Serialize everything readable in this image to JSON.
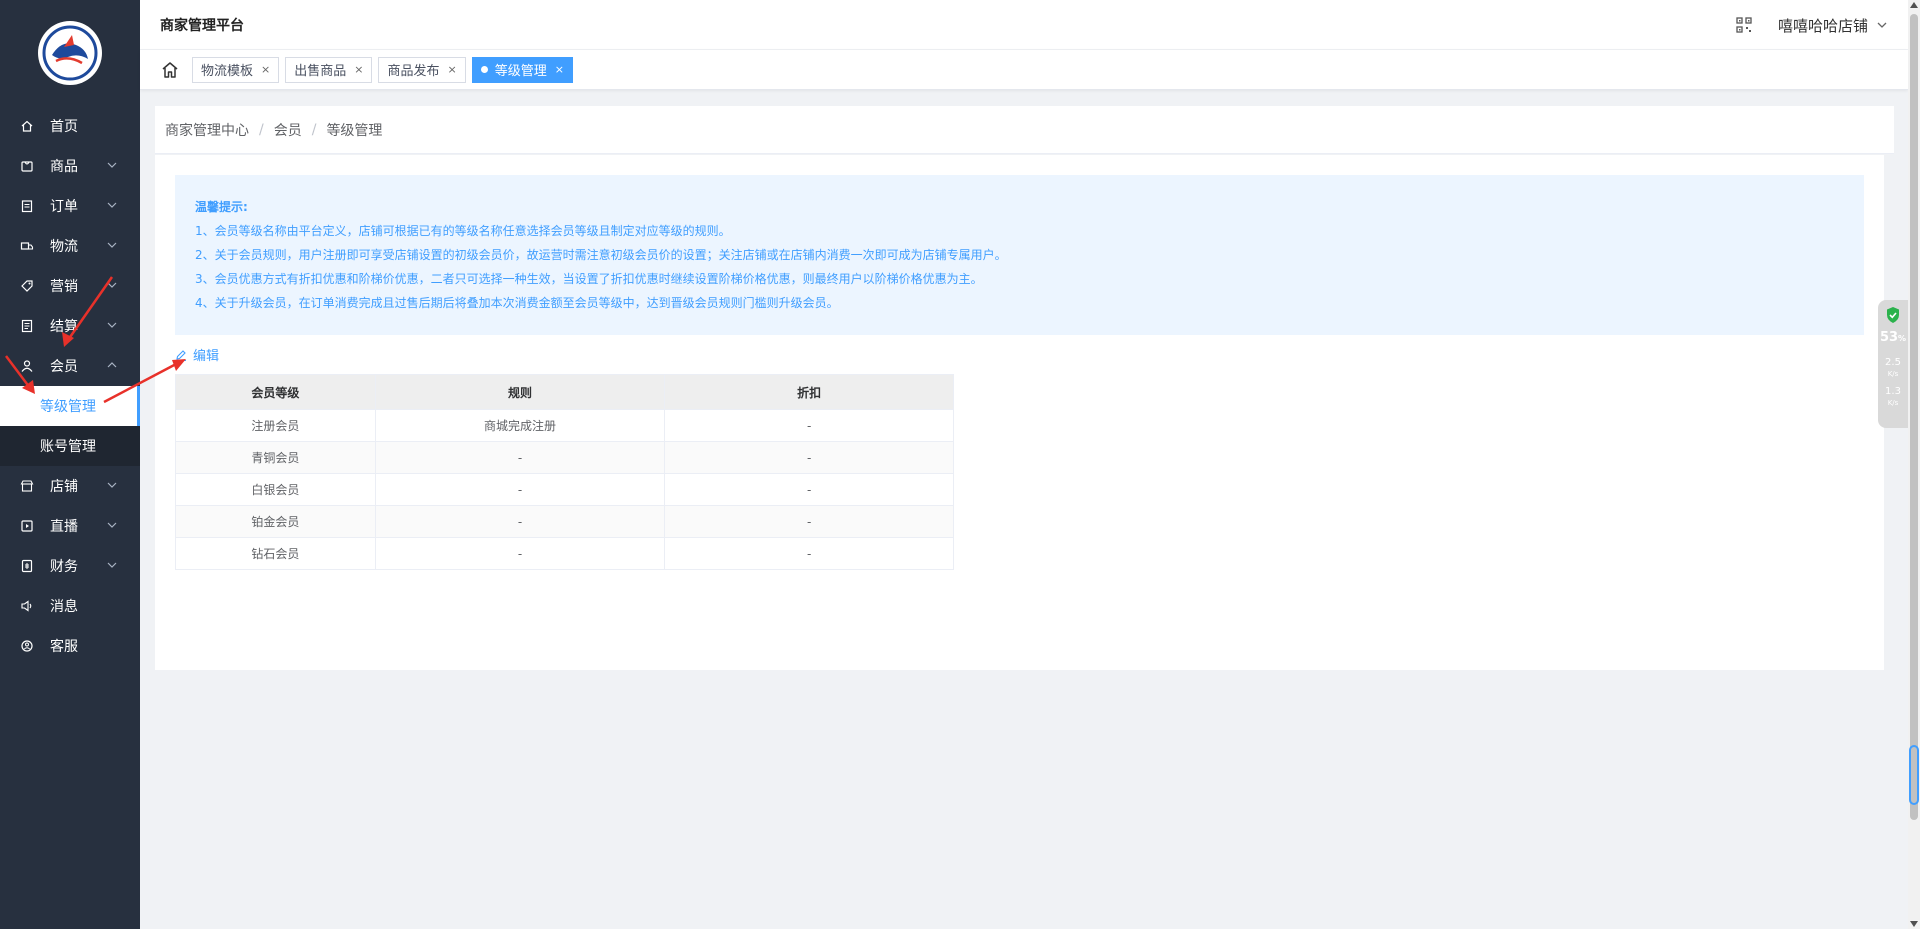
{
  "header": {
    "platform_title": "商家管理平台",
    "shop_name": "嘻嘻哈哈店铺"
  },
  "sidebar": {
    "items": [
      {
        "label": "首页",
        "icon": "home-icon",
        "has_children": false
      },
      {
        "label": "商品",
        "icon": "goods-icon",
        "has_children": true
      },
      {
        "label": "订单",
        "icon": "order-icon",
        "has_children": true
      },
      {
        "label": "物流",
        "icon": "truck-icon",
        "has_children": true
      },
      {
        "label": "营销",
        "icon": "tag-icon",
        "has_children": true
      },
      {
        "label": "结算",
        "icon": "ledger-icon",
        "has_children": true
      },
      {
        "label": "会员",
        "icon": "user-icon",
        "has_children": true,
        "expanded": true
      },
      {
        "label": "店铺",
        "icon": "shop-icon",
        "has_children": true
      },
      {
        "label": "直播",
        "icon": "live-icon",
        "has_children": true
      },
      {
        "label": "财务",
        "icon": "finance-icon",
        "has_children": true
      },
      {
        "label": "消息",
        "icon": "speaker-icon",
        "has_children": false
      },
      {
        "label": "客服",
        "icon": "service-icon",
        "has_children": false
      }
    ],
    "member_submenu": [
      {
        "label": "等级管理",
        "active": true
      },
      {
        "label": "账号管理",
        "active": false
      }
    ]
  },
  "tabs": [
    {
      "label": "物流模板",
      "active": false
    },
    {
      "label": "出售商品",
      "active": false
    },
    {
      "label": "商品发布",
      "active": false
    },
    {
      "label": "等级管理",
      "active": true
    }
  ],
  "tab_close_glyph": "×",
  "breadcrumb": [
    "商家管理中心",
    "会员",
    "等级管理"
  ],
  "breadcrumb_sep": "/",
  "tips": {
    "title": "温馨提示:",
    "lines": [
      "1、会员等级名称由平台定义，店铺可根据已有的等级名称任意选择会员等级且制定对应等级的规则。",
      "2、关于会员规则，用户注册即可享受店铺设置的初级会员价，故运营时需注意初级会员价的设置；关注店铺或在店铺内消费一次即可成为店铺专属用户。",
      "3、会员优惠方式有折扣优惠和阶梯价优惠，二者只可选择一种生效，当设置了折扣优惠时继续设置阶梯价格优惠，则最终用户以阶梯价格优惠为主。",
      "4、关于升级会员，在订单消费完成且过售后期后将叠加本次消费金额至会员等级中，达到晋级会员规则门槛则升级会员。"
    ]
  },
  "edit_label": "编辑",
  "table": {
    "headers": [
      "会员等级",
      "规则",
      "折扣"
    ],
    "rows": [
      [
        "注册会员",
        "商城完成注册",
        "-"
      ],
      [
        "青铜会员",
        "-",
        "-"
      ],
      [
        "白银会员",
        "-",
        "-"
      ],
      [
        "铂金会员",
        "-",
        "-"
      ],
      [
        "钻石会员",
        "-",
        "-"
      ]
    ]
  },
  "widget": {
    "percent": "53",
    "percent_unit": "%",
    "up_speed": "2.5",
    "up_unit": "K/s",
    "down_speed": "1.3",
    "down_unit": "K/s"
  },
  "colors": {
    "sidebar_bg": "#27303f",
    "accent": "#409eff",
    "annotation_arrow": "#e8312a"
  }
}
